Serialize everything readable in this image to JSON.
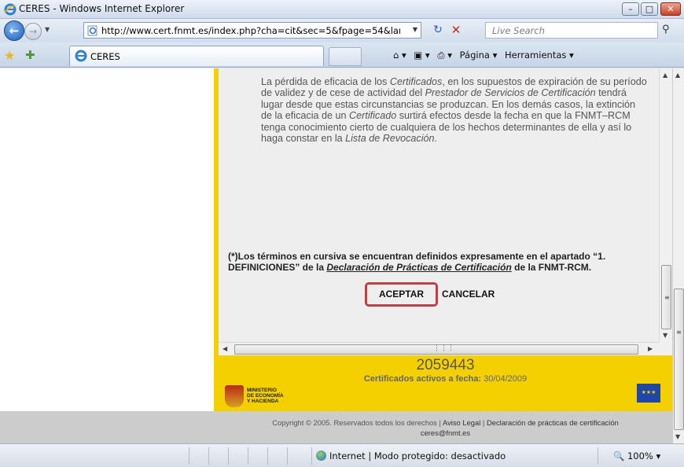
{
  "window": {
    "title": "CERES - Windows Internet Explorer",
    "minimize": "–",
    "maximize": "□",
    "close": "✕"
  },
  "address_bar": {
    "url": "http://www.cert.fnmt.es/index.php?cha=cit&sec=5&fpage=54&lang:",
    "search_placeholder": "Live Search"
  },
  "tab": {
    "title": "CERES"
  },
  "toolbar": {
    "home": "⌂ ▾",
    "feeds": "▣ ▾",
    "print": "⎙ ▾",
    "page": "Página ▾",
    "tools": "Herramientas ▾"
  },
  "content": {
    "paragraph_html": "La pérdida de eficacia de los <i>Certificados</i>, en los supuestos de expiración de su período de validez y de cese de actividad del <i>Prestador de Servicios de Certificación</i> tendrá lugar desde que estas circunstancias se produzcan. En los demás casos, la extinción de la eficacia de un <i>Certificado</i> surtirá efectos desde la fecha en que la FNMT–RCM tenga conocimiento cierto de cualquiera de los hechos determinantes de ella y así lo haga constar en la <i>Lista de Revocación</i>.",
    "note_prefix": "(*)Los términos en cursiva se encuentran definidos expresamente en el apartado “1. DEFINICIONES” de la ",
    "note_link": "Declaración de Prácticas de Certificación",
    "note_suffix": " de la FNMT-RCM.",
    "accept_label": "ACEPTAR",
    "cancel_label": "CANCELAR"
  },
  "footer": {
    "count": "2059443",
    "count_label": "Certificados activos a fecha:",
    "count_date": "30/04/2009",
    "ministry_line1": "MINISTERIO",
    "ministry_line2": "DE ECONOMÍA",
    "ministry_line3": "Y HACIENDA",
    "copyright": "Copyright © 2005. Reservados todos los derechos |",
    "aviso_legal": "Aviso Legal",
    "sep": "|",
    "declaracion": "Declaración de prácticas de certificación",
    "email": "ceres@fnmt.es"
  },
  "status_bar": {
    "zone": "Internet | Modo protegido: desactivado",
    "zoom": "🔍 100%  ▾"
  }
}
